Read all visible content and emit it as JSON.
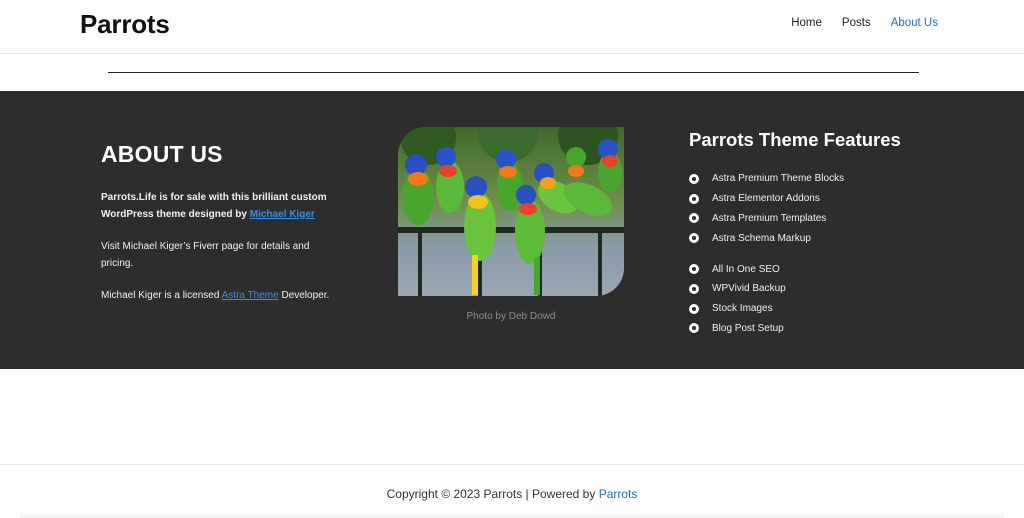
{
  "header": {
    "site_title": "Parrots",
    "nav": [
      {
        "label": "Home"
      },
      {
        "label": "Posts"
      },
      {
        "label": "About Us"
      }
    ]
  },
  "about": {
    "heading": "ABOUT US",
    "intro": "Parrots.Life is for sale with this brilliant custom WordPress theme designed by ",
    "intro_link": "Michael Kiger",
    "visit": "Visit Michael Kiger’s Fiverr page for details and pricing.",
    "licensed_before": "Michael Kiger is a licensed ",
    "licensed_link": "Astra Theme",
    "licensed_after": " Developer."
  },
  "photo": {
    "caption": "Photo by Deb Dowd"
  },
  "features": {
    "heading": "Parrots Theme Features",
    "group1": [
      "Astra Premium Theme Blocks",
      "Astra Elementor Addons",
      "Astra Premium Templates",
      "Astra Schema Markup"
    ],
    "group2": [
      "All In One SEO",
      "WPVivid Backup",
      "Stock Images",
      "Blog Post Setup"
    ]
  },
  "footer": {
    "copyright": "Copyright © 2023 Parrots | Powered by ",
    "powered_link": "Parrots"
  },
  "colors": {
    "accent": "#1e6fb8",
    "dark_section": "#2d2d2d",
    "link_on_dark": "#3a8de0"
  }
}
